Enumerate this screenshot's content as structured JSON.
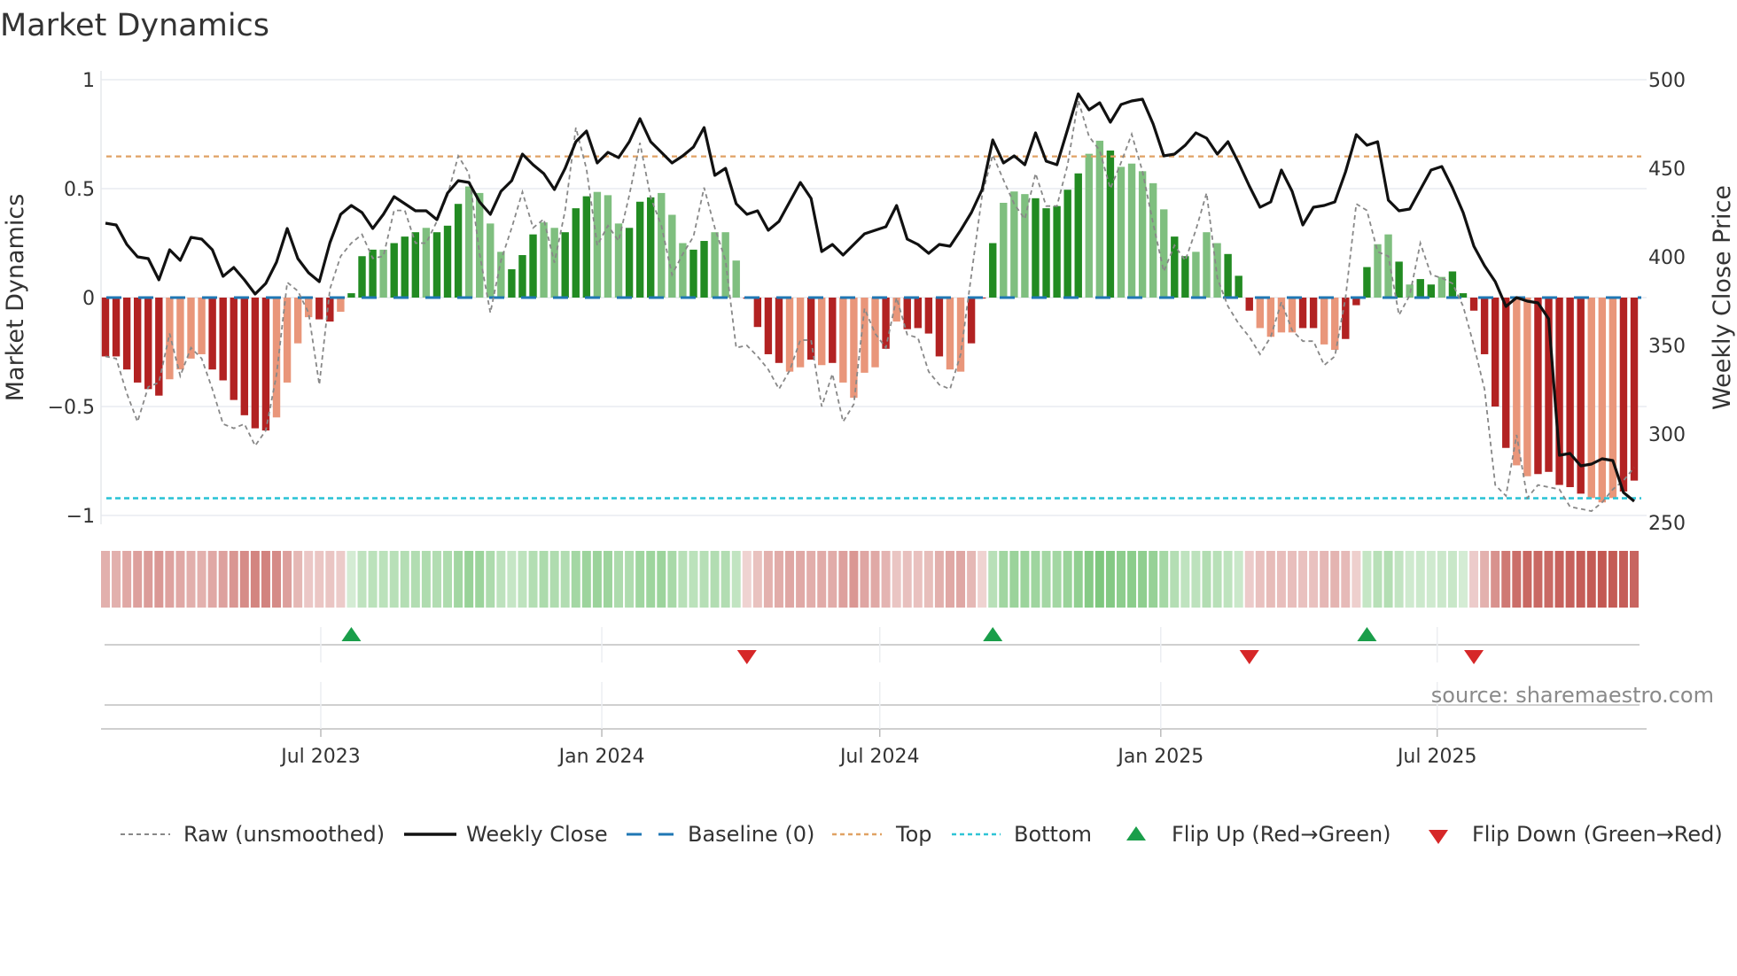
{
  "chart_data": {
    "type": "bar",
    "title": "Market Dynamics",
    "ylabel": "Market Dynamics",
    "ylabel_right": "Weekly Close Price",
    "ylim": [
      -1,
      1
    ],
    "ylim_right": [
      250,
      500
    ],
    "yticks": [
      {
        "v": 1,
        "label": "1"
      },
      {
        "v": 0.5,
        "label": "0.5"
      },
      {
        "v": 0,
        "label": "0"
      },
      {
        "v": -0.5,
        "label": "−0.5"
      },
      {
        "v": -1,
        "label": "−1"
      }
    ],
    "yticks_right": [
      {
        "v": 500,
        "label": "500"
      },
      {
        "v": 450,
        "label": "450"
      },
      {
        "v": 400,
        "label": "400"
      },
      {
        "v": 350,
        "label": "350"
      },
      {
        "v": 300,
        "label": "300"
      },
      {
        "v": 250,
        "label": "250"
      }
    ],
    "start_date": "2023-02-10",
    "frequency": "weekly",
    "xticks": [
      {
        "date": "2023-07-01",
        "label": "Jul 2023"
      },
      {
        "date": "2024-01-01",
        "label": "Jan 2024"
      },
      {
        "date": "2024-07-01",
        "label": "Jul 2024"
      },
      {
        "date": "2025-01-01",
        "label": "Jan 2025"
      },
      {
        "date": "2025-07-01",
        "label": "Jul 2025"
      }
    ],
    "top_level": 0.648,
    "bottom_level": -0.921,
    "baseline": 0,
    "colors": {
      "bar_dark_red": "#b22222",
      "bar_light_red": "#e9967a",
      "bar_dark_green": "#228b22",
      "bar_light_green": "#7fbf7f",
      "close": "#111111",
      "raw": "#888888",
      "baseline": "#1f77b4",
      "top": "#e0a264",
      "bottom": "#2ec4d6",
      "flip_up": "#1a9e4a",
      "flip_down": "#d62728",
      "strip_red": "#c0504a",
      "strip_green": "#5cb85c"
    },
    "series": [
      {
        "name": "Market Dynamics (smoothed)",
        "values": [
          -0.27,
          -0.27,
          -0.33,
          -0.39,
          -0.42,
          -0.45,
          -0.375,
          -0.33,
          -0.28,
          -0.26,
          -0.33,
          -0.38,
          -0.47,
          -0.54,
          -0.6,
          -0.61,
          -0.55,
          -0.39,
          -0.21,
          -0.09,
          -0.1,
          -0.11,
          -0.065,
          0.02,
          0.19,
          0.22,
          0.22,
          0.25,
          0.28,
          0.3,
          0.32,
          0.3,
          0.33,
          0.43,
          0.51,
          0.48,
          0.34,
          0.21,
          0.13,
          0.195,
          0.29,
          0.345,
          0.32,
          0.3,
          0.41,
          0.465,
          0.485,
          0.47,
          0.34,
          0.32,
          0.44,
          0.46,
          0.48,
          0.38,
          0.25,
          0.22,
          0.26,
          0.3,
          0.3,
          0.17,
          -0.005,
          -0.135,
          -0.26,
          -0.3,
          -0.34,
          -0.32,
          -0.285,
          -0.31,
          -0.3,
          -0.39,
          -0.46,
          -0.345,
          -0.32,
          -0.235,
          -0.11,
          -0.145,
          -0.14,
          -0.165,
          -0.27,
          -0.33,
          -0.34,
          -0.21,
          -0.003,
          0.25,
          0.435,
          0.487,
          0.475,
          0.456,
          0.41,
          0.42,
          0.495,
          0.57,
          0.66,
          0.72,
          0.675,
          0.6,
          0.615,
          0.58,
          0.525,
          0.405,
          0.28,
          0.19,
          0.21,
          0.3,
          0.25,
          0.2,
          0.1,
          -0.06,
          -0.14,
          -0.18,
          -0.16,
          -0.16,
          -0.14,
          -0.14,
          -0.215,
          -0.24,
          -0.19,
          -0.035,
          0.14,
          0.245,
          0.29,
          0.165,
          0.06,
          0.085,
          0.06,
          0.095,
          0.12,
          0.02,
          -0.06,
          -0.26,
          -0.5,
          -0.69,
          -0.77,
          -0.82,
          -0.81,
          -0.8,
          -0.86,
          -0.87,
          -0.9,
          -0.92,
          -0.94,
          -0.92,
          -0.89,
          -0.84
        ],
        "shade": "ddddddllllddddddllllddldddldddldddlllldddlldddllldddllldd lllddddlldldlllldldddd lldddllldddddlldlllllddlllddd llllddllddd lldlddlddddddllddddd lll"
      },
      {
        "name": "Raw (unsmoothed)",
        "values": [
          -0.27,
          -0.28,
          -0.44,
          -0.57,
          -0.41,
          -0.39,
          -0.165,
          -0.36,
          -0.23,
          -0.28,
          -0.42,
          -0.58,
          -0.6,
          -0.58,
          -0.68,
          -0.61,
          -0.355,
          0.07,
          0.03,
          -0.07,
          -0.4,
          0.04,
          0.19,
          0.25,
          0.29,
          0.18,
          0.19,
          0.4,
          0.4,
          0.25,
          0.25,
          0.35,
          0.47,
          0.65,
          0.57,
          0.2,
          -0.07,
          0.17,
          0.32,
          0.485,
          0.32,
          0.36,
          0.16,
          0.4,
          0.78,
          0.59,
          0.24,
          0.33,
          0.26,
          0.47,
          0.71,
          0.46,
          0.33,
          0.105,
          0.2,
          0.28,
          0.505,
          0.32,
          0.17,
          -0.23,
          -0.22,
          -0.27,
          -0.33,
          -0.42,
          -0.335,
          -0.195,
          -0.195,
          -0.5,
          -0.35,
          -0.57,
          -0.49,
          -0.05,
          -0.165,
          -0.23,
          0.0,
          -0.17,
          -0.185,
          -0.34,
          -0.4,
          -0.42,
          -0.26,
          0.105,
          0.47,
          0.655,
          0.54,
          0.43,
          0.36,
          0.57,
          0.42,
          0.42,
          0.61,
          0.905,
          0.74,
          0.675,
          0.5,
          0.62,
          0.75,
          0.58,
          0.34,
          0.12,
          0.24,
          0.17,
          0.31,
          0.48,
          0.09,
          -0.04,
          -0.12,
          -0.18,
          -0.26,
          -0.18,
          -0.02,
          -0.15,
          -0.2,
          -0.2,
          -0.31,
          -0.27,
          0.0,
          0.43,
          0.4,
          0.21,
          0.19,
          -0.08,
          0.01,
          0.25,
          0.105,
          0.09,
          0.065,
          -0.04,
          -0.22,
          -0.42,
          -0.86,
          -0.91,
          -0.63,
          -0.92,
          -0.86,
          -0.87,
          -0.88,
          -0.96,
          -0.97,
          -0.98,
          -0.94,
          -0.88,
          -0.84,
          -0.78
        ]
      },
      {
        "name": "Weekly Close",
        "axis": "right",
        "values": [
          419,
          418,
          407,
          400,
          399,
          387,
          404,
          398,
          411,
          410,
          404,
          389,
          394,
          387,
          379,
          385,
          397,
          416,
          399,
          391,
          386,
          408,
          424,
          429,
          425,
          416,
          424,
          434,
          430,
          426,
          426,
          421,
          436,
          443,
          442,
          431,
          424,
          437,
          443,
          458,
          452,
          447,
          438,
          450,
          465,
          471,
          453,
          459,
          456,
          465,
          478,
          465,
          459,
          453,
          457,
          462,
          473,
          446,
          450,
          430,
          424,
          426,
          415,
          420,
          431,
          442,
          433,
          403,
          407,
          401,
          407,
          413,
          415,
          417,
          429,
          410,
          407,
          402,
          407,
          406,
          415,
          425,
          438,
          466,
          453,
          457,
          452,
          470,
          454,
          452,
          472,
          492,
          483,
          487,
          476,
          486,
          488,
          489,
          475,
          457,
          458,
          463,
          470,
          467,
          458,
          465,
          453,
          440,
          428,
          431,
          449,
          437,
          418,
          428,
          429,
          431,
          448,
          469,
          463,
          465,
          432,
          426,
          427,
          438,
          449,
          451,
          439,
          425,
          406,
          395,
          386,
          372,
          377,
          375,
          374,
          365,
          288,
          289,
          282,
          283,
          286,
          285,
          267,
          262
        ]
      }
    ],
    "flips": [
      {
        "type": "up",
        "week_index": 23
      },
      {
        "type": "down",
        "week_index": 60
      },
      {
        "type": "up",
        "week_index": 83
      },
      {
        "type": "down",
        "week_index": 107
      },
      {
        "type": "up",
        "week_index": 118
      },
      {
        "type": "down",
        "week_index": 128
      }
    ],
    "legend": {
      "position": "bottom",
      "items": [
        "Raw (unsmoothed)",
        "Weekly Close",
        "Baseline (0)",
        "Top",
        "Bottom",
        "Flip Up (Red→Green)",
        "Flip Down (Green→Red)"
      ]
    },
    "annotation": "source: sharemaestro.com"
  }
}
